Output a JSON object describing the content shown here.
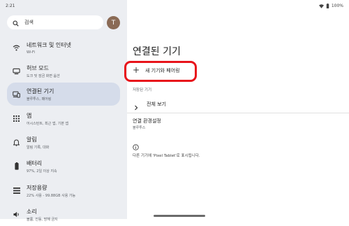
{
  "status": {
    "time": "2:21",
    "battery": "100%"
  },
  "search": {
    "text": "검색"
  },
  "avatar": {
    "letter": "T"
  },
  "sidebar": {
    "items": [
      {
        "icon": "wifi-icon",
        "title": "네트워크 및 인터넷",
        "subtitle": "Wi-Fi"
      },
      {
        "icon": "dock-icon",
        "title": "허브 모드",
        "subtitle": "도크 및 잠금 화면 옵션"
      },
      {
        "icon": "connected-devices-icon",
        "title": "연결된 기기",
        "subtitle": "블루투스, 페어링"
      },
      {
        "icon": "apps-grid-icon",
        "title": "앱",
        "subtitle": "어시스턴트, 최근 앱, 기본 앱"
      },
      {
        "icon": "bell-icon",
        "title": "알림",
        "subtitle": "알림 기록, 대화"
      },
      {
        "icon": "battery-icon",
        "title": "배터리",
        "subtitle": "97%, 2일 이상 지속"
      },
      {
        "icon": "storage-icon",
        "title": "저장용량",
        "subtitle": "22% 사용 - 99.88GB 사용 가능"
      },
      {
        "icon": "volume-icon",
        "title": "소리",
        "subtitle": "볼륨, 진동, 방해 금지"
      }
    ]
  },
  "main": {
    "title": "연결된 기기",
    "pair_new": "새 기기와 페어링",
    "section_header": "저장된 기기",
    "see_all": "전체 보기",
    "prefs_title": "연결 환경설정",
    "prefs_subtitle": "블루투스",
    "info_text": "다른 기기에 'Pixel Tablet'로 표시됩니다."
  },
  "colors": {
    "sidebar_bg": "#eceef2",
    "active_item": "#d5dcea",
    "highlight": "#e8141b",
    "avatar": "#8a6a55"
  }
}
